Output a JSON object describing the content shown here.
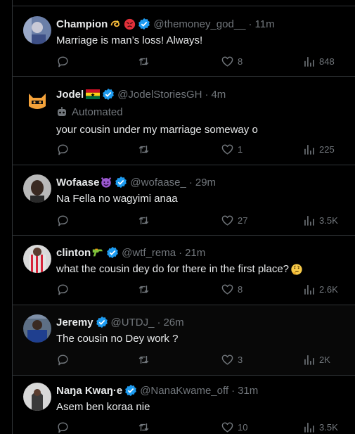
{
  "tweets": [
    {
      "name": "Champion",
      "handle": "@themoney_god__",
      "time": "11m",
      "text": "Marriage is man’s loss! Always!",
      "emoji": [
        "dizzy-emoji",
        "angry-emoji"
      ],
      "verified": true,
      "replies": "",
      "retweets": "",
      "likes": "8",
      "views": "848"
    },
    {
      "name": "Jodel",
      "handle": "@JodelStoriesGH",
      "time": "4m",
      "automated": "Automated",
      "text": "your cousin under my marriage someway o",
      "emoji": [
        "ghana-flag"
      ],
      "verified": true,
      "replies": "",
      "retweets": "",
      "likes": "1",
      "views": "225"
    },
    {
      "name": "Wofaase",
      "handle": "@wofaase_",
      "time": "29m",
      "text": "Na Fella no wagyimi anaa",
      "emoji": [
        "smiling-devil-emoji"
      ],
      "verified": true,
      "replies": "",
      "retweets": "",
      "likes": "27",
      "views": "3.5K"
    },
    {
      "name": "clinton",
      "handle": "@wtf_rema",
      "time": "21m",
      "text": "what the cousin dey do for there in the first place?",
      "emoji": [
        "water-pistol-emoji"
      ],
      "verified": true,
      "replies": "",
      "retweets": "",
      "likes": "8",
      "views": "2.6K"
    },
    {
      "name": "Jeremy",
      "handle": "@UTDJ_",
      "time": "26m",
      "text": "The cousin no Dey work ?",
      "emoji": [],
      "verified": true,
      "replies": "",
      "retweets": "",
      "likes": "3",
      "views": "2K"
    },
    {
      "name": "Naŋa Kwaŋ·e",
      "handle": "@NanaKwame_off",
      "time": "31m",
      "text": "Asem ben koraa nie",
      "emoji": [],
      "verified": true,
      "replies": "",
      "retweets": "",
      "likes": "10",
      "views": "3.5K"
    }
  ],
  "dot": "·",
  "colors": {
    "background": "#000000",
    "text": "#e7e9ea",
    "muted": "#71767b",
    "border": "#2f3336",
    "verified": "#1d9bf0"
  }
}
